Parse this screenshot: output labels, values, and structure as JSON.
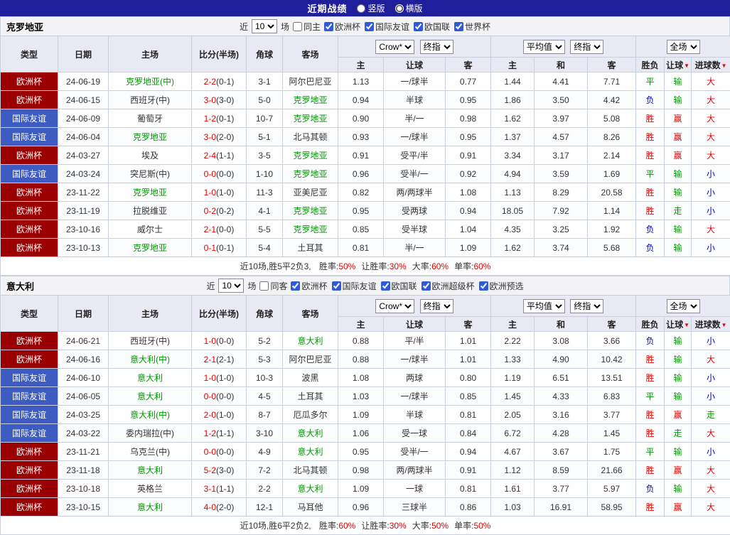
{
  "colors": {
    "navy": "#1f1f9c",
    "red": "#e60000",
    "green": "#009900",
    "blue": "#0000cc",
    "league_red": "#9a0000",
    "league_blue": "#3d5bc0"
  },
  "result_colors": {
    "胜": "red",
    "赢": "red",
    "大": "red",
    "平": "green",
    "走": "green",
    "输": "green",
    "负": "blue",
    "小": "blue"
  },
  "titlebar": {
    "title": "近期战绩",
    "radio_vertical": "竖版",
    "radio_horizontal": "横版",
    "selected": "横版"
  },
  "filters": {
    "near_label": "近",
    "count_value": "10",
    "games_label": "场"
  },
  "table_header": {
    "col_type": "类型",
    "col_date": "日期",
    "col_home": "主场",
    "col_score": "比分(半场)",
    "col_corner": "角球",
    "col_away": "客场",
    "bookmaker_select": "Crow*",
    "final_select": "终指",
    "avg_select": "平均值",
    "avg_final_select": "终指",
    "fulltime_select": "全场",
    "sub_home": "主",
    "sub_handicap": "让球",
    "sub_away": "客",
    "sub_avg_home": "主",
    "sub_draw": "和",
    "sub_avg_away": "客",
    "sub_result": "胜负",
    "sub_handicap_result": "让球",
    "sub_goals": "进球数"
  },
  "sections": [
    {
      "team": "克罗地亚",
      "same_venue_label": "同主",
      "same_venue_checked": false,
      "leagues": [
        {
          "label": "欧洲杯",
          "checked": true
        },
        {
          "label": "国际友谊",
          "checked": true
        },
        {
          "label": "欧国联",
          "checked": true
        },
        {
          "label": "世界杯",
          "checked": true
        }
      ],
      "rows": [
        {
          "league": "欧洲杯",
          "league_color": "red",
          "date": "24-06-19",
          "home": "克罗地亚(中)",
          "home_highlight": true,
          "score": "2-2",
          "half": "(0-1)",
          "corner": "3-1",
          "away": "阿尔巴尼亚",
          "away_highlight": false,
          "asian": [
            "1.13",
            "一/球半",
            "0.77"
          ],
          "euro": [
            "1.44",
            "4.41",
            "7.71"
          ],
          "results": [
            "平",
            "输",
            "大"
          ]
        },
        {
          "league": "欧洲杯",
          "league_color": "red",
          "date": "24-06-15",
          "home": "西班牙(中)",
          "home_highlight": false,
          "score": "3-0",
          "half": "(3-0)",
          "corner": "5-0",
          "away": "克罗地亚",
          "away_highlight": true,
          "asian": [
            "0.94",
            "半球",
            "0.95"
          ],
          "euro": [
            "1.86",
            "3.50",
            "4.42"
          ],
          "results": [
            "负",
            "输",
            "大"
          ]
        },
        {
          "league": "国际友谊",
          "league_color": "blue",
          "date": "24-06-09",
          "home": "葡萄牙",
          "home_highlight": false,
          "score": "1-2",
          "half": "(0-1)",
          "corner": "10-7",
          "away": "克罗地亚",
          "away_highlight": true,
          "asian": [
            "0.90",
            "半/一",
            "0.98"
          ],
          "euro": [
            "1.62",
            "3.97",
            "5.08"
          ],
          "results": [
            "胜",
            "赢",
            "大"
          ]
        },
        {
          "league": "国际友谊",
          "league_color": "blue",
          "date": "24-06-04",
          "home": "克罗地亚",
          "home_highlight": true,
          "score": "3-0",
          "half": "(2-0)",
          "corner": "5-1",
          "away": "北马其顿",
          "away_highlight": false,
          "asian": [
            "0.93",
            "一/球半",
            "0.95"
          ],
          "euro": [
            "1.37",
            "4.57",
            "8.26"
          ],
          "results": [
            "胜",
            "赢",
            "大"
          ]
        },
        {
          "league": "欧洲杯",
          "league_color": "red",
          "date": "24-03-27",
          "home": "埃及",
          "home_highlight": false,
          "score": "2-4",
          "half": "(1-1)",
          "corner": "3-5",
          "away": "克罗地亚",
          "away_highlight": true,
          "asian": [
            "0.91",
            "受平/半",
            "0.91"
          ],
          "euro": [
            "3.34",
            "3.17",
            "2.14"
          ],
          "results": [
            "胜",
            "赢",
            "大"
          ]
        },
        {
          "league": "国际友谊",
          "league_color": "blue",
          "date": "24-03-24",
          "home": "突尼斯(中)",
          "home_highlight": false,
          "score": "0-0",
          "half": "(0-0)",
          "corner": "1-10",
          "away": "克罗地亚",
          "away_highlight": true,
          "asian": [
            "0.96",
            "受半/一",
            "0.92"
          ],
          "euro": [
            "4.94",
            "3.59",
            "1.69"
          ],
          "results": [
            "平",
            "输",
            "小"
          ]
        },
        {
          "league": "欧洲杯",
          "league_color": "red",
          "date": "23-11-22",
          "home": "克罗地亚",
          "home_highlight": true,
          "score": "1-0",
          "half": "(1-0)",
          "corner": "11-3",
          "away": "亚美尼亚",
          "away_highlight": false,
          "asian": [
            "0.82",
            "两/两球半",
            "1.08"
          ],
          "euro": [
            "1.13",
            "8.29",
            "20.58"
          ],
          "results": [
            "胜",
            "输",
            "小"
          ]
        },
        {
          "league": "欧洲杯",
          "league_color": "red",
          "date": "23-11-19",
          "home": "拉脱维亚",
          "home_highlight": false,
          "score": "0-2",
          "half": "(0-2)",
          "corner": "4-1",
          "away": "克罗地亚",
          "away_highlight": true,
          "asian": [
            "0.95",
            "受两球",
            "0.94"
          ],
          "euro": [
            "18.05",
            "7.92",
            "1.14"
          ],
          "results": [
            "胜",
            "走",
            "小"
          ]
        },
        {
          "league": "欧洲杯",
          "league_color": "red",
          "date": "23-10-16",
          "home": "威尔士",
          "home_highlight": false,
          "score": "2-1",
          "half": "(0-0)",
          "corner": "5-5",
          "away": "克罗地亚",
          "away_highlight": true,
          "asian": [
            "0.85",
            "受半球",
            "1.04"
          ],
          "euro": [
            "4.35",
            "3.25",
            "1.92"
          ],
          "results": [
            "负",
            "输",
            "大"
          ]
        },
        {
          "league": "欧洲杯",
          "league_color": "red",
          "date": "23-10-13",
          "home": "克罗地亚",
          "home_highlight": true,
          "score": "0-1",
          "half": "(0-1)",
          "corner": "5-4",
          "away": "土耳其",
          "away_highlight": false,
          "asian": [
            "0.81",
            "半/一",
            "1.09"
          ],
          "euro": [
            "1.62",
            "3.74",
            "5.68"
          ],
          "results": [
            "负",
            "输",
            "小"
          ]
        }
      ],
      "summary": {
        "prefix": "近10场,胜5平2负3,",
        "stats": [
          {
            "label": "胜率:",
            "value": "50%"
          },
          {
            "label": "让胜率:",
            "value": "30%"
          },
          {
            "label": "大率:",
            "value": "60%"
          },
          {
            "label": "单率:",
            "value": "60%"
          }
        ]
      }
    },
    {
      "team": "意大利",
      "same_venue_label": "同客",
      "same_venue_checked": false,
      "leagues": [
        {
          "label": "欧洲杯",
          "checked": true
        },
        {
          "label": "国际友谊",
          "checked": true
        },
        {
          "label": "欧国联",
          "checked": true
        },
        {
          "label": "欧洲超级杯",
          "checked": true
        },
        {
          "label": "欧洲预选",
          "checked": true
        }
      ],
      "rows": [
        {
          "league": "欧洲杯",
          "league_color": "red",
          "date": "24-06-21",
          "home": "西班牙(中)",
          "home_highlight": false,
          "score": "1-0",
          "half": "(0-0)",
          "corner": "5-2",
          "away": "意大利",
          "away_highlight": true,
          "asian": [
            "0.88",
            "平/半",
            "1.01"
          ],
          "euro": [
            "2.22",
            "3.08",
            "3.66"
          ],
          "results": [
            "负",
            "输",
            "小"
          ]
        },
        {
          "league": "欧洲杯",
          "league_color": "red",
          "date": "24-06-16",
          "home": "意大利(中)",
          "home_highlight": true,
          "score": "2-1",
          "half": "(2-1)",
          "corner": "5-3",
          "away": "阿尔巴尼亚",
          "away_highlight": false,
          "asian": [
            "0.88",
            "一/球半",
            "1.01"
          ],
          "euro": [
            "1.33",
            "4.90",
            "10.42"
          ],
          "results": [
            "胜",
            "输",
            "大"
          ]
        },
        {
          "league": "国际友谊",
          "league_color": "blue",
          "date": "24-06-10",
          "home": "意大利",
          "home_highlight": true,
          "score": "1-0",
          "half": "(1-0)",
          "corner": "10-3",
          "away": "波黑",
          "away_highlight": false,
          "asian": [
            "1.08",
            "两球",
            "0.80"
          ],
          "euro": [
            "1.19",
            "6.51",
            "13.51"
          ],
          "results": [
            "胜",
            "输",
            "小"
          ]
        },
        {
          "league": "国际友谊",
          "league_color": "blue",
          "date": "24-06-05",
          "home": "意大利",
          "home_highlight": true,
          "score": "0-0",
          "half": "(0-0)",
          "corner": "4-5",
          "away": "土耳其",
          "away_highlight": false,
          "asian": [
            "1.03",
            "一/球半",
            "0.85"
          ],
          "euro": [
            "1.45",
            "4.33",
            "6.83"
          ],
          "results": [
            "平",
            "输",
            "小"
          ]
        },
        {
          "league": "国际友谊",
          "league_color": "blue",
          "date": "24-03-25",
          "home": "意大利(中)",
          "home_highlight": true,
          "score": "2-0",
          "half": "(1-0)",
          "corner": "8-7",
          "away": "厄瓜多尔",
          "away_highlight": false,
          "asian": [
            "1.09",
            "半球",
            "0.81"
          ],
          "euro": [
            "2.05",
            "3.16",
            "3.77"
          ],
          "results": [
            "胜",
            "赢",
            "走"
          ]
        },
        {
          "league": "国际友谊",
          "league_color": "blue",
          "date": "24-03-22",
          "home": "委内瑞拉(中)",
          "home_highlight": false,
          "score": "1-2",
          "half": "(1-1)",
          "corner": "3-10",
          "away": "意大利",
          "away_highlight": true,
          "asian": [
            "1.06",
            "受一球",
            "0.84"
          ],
          "euro": [
            "6.72",
            "4.28",
            "1.45"
          ],
          "results": [
            "胜",
            "走",
            "大"
          ]
        },
        {
          "league": "欧洲杯",
          "league_color": "red",
          "date": "23-11-21",
          "home": "乌克兰(中)",
          "home_highlight": false,
          "score": "0-0",
          "half": "(0-0)",
          "corner": "4-9",
          "away": "意大利",
          "away_highlight": true,
          "asian": [
            "0.95",
            "受半/一",
            "0.94"
          ],
          "euro": [
            "4.67",
            "3.67",
            "1.75"
          ],
          "results": [
            "平",
            "输",
            "小"
          ]
        },
        {
          "league": "欧洲杯",
          "league_color": "red",
          "date": "23-11-18",
          "home": "意大利",
          "home_highlight": true,
          "score": "5-2",
          "half": "(3-0)",
          "corner": "7-2",
          "away": "北马其顿",
          "away_highlight": false,
          "asian": [
            "0.98",
            "两/两球半",
            "0.91"
          ],
          "euro": [
            "1.12",
            "8.59",
            "21.66"
          ],
          "results": [
            "胜",
            "赢",
            "大"
          ]
        },
        {
          "league": "欧洲杯",
          "league_color": "red",
          "date": "23-10-18",
          "home": "英格兰",
          "home_highlight": false,
          "score": "3-1",
          "half": "(1-1)",
          "corner": "2-2",
          "away": "意大利",
          "away_highlight": true,
          "asian": [
            "1.09",
            "一球",
            "0.81"
          ],
          "euro": [
            "1.61",
            "3.77",
            "5.97"
          ],
          "results": [
            "负",
            "输",
            "大"
          ]
        },
        {
          "league": "欧洲杯",
          "league_color": "red",
          "date": "23-10-15",
          "home": "意大利",
          "home_highlight": true,
          "score": "4-0",
          "half": "(2-0)",
          "corner": "12-1",
          "away": "马耳他",
          "away_highlight": false,
          "asian": [
            "0.96",
            "三球半",
            "0.86"
          ],
          "euro": [
            "1.03",
            "16.91",
            "58.95"
          ],
          "results": [
            "胜",
            "赢",
            "大"
          ]
        }
      ],
      "summary": {
        "prefix": "近10场,胜6平2负2,",
        "stats": [
          {
            "label": "胜率:",
            "value": "60%"
          },
          {
            "label": "让胜率:",
            "value": "30%"
          },
          {
            "label": "大率:",
            "value": "50%"
          },
          {
            "label": "单率:",
            "value": "50%"
          }
        ]
      }
    }
  ]
}
